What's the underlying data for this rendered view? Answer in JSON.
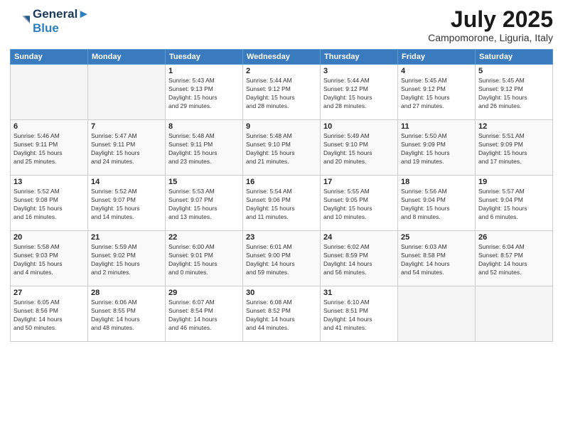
{
  "logo": {
    "line1": "General",
    "line2": "Blue"
  },
  "title": "July 2025",
  "subtitle": "Campomorone, Liguria, Italy",
  "header_days": [
    "Sunday",
    "Monday",
    "Tuesday",
    "Wednesday",
    "Thursday",
    "Friday",
    "Saturday"
  ],
  "weeks": [
    [
      {
        "day": "",
        "info": ""
      },
      {
        "day": "",
        "info": ""
      },
      {
        "day": "1",
        "info": "Sunrise: 5:43 AM\nSunset: 9:13 PM\nDaylight: 15 hours\nand 29 minutes."
      },
      {
        "day": "2",
        "info": "Sunrise: 5:44 AM\nSunset: 9:12 PM\nDaylight: 15 hours\nand 28 minutes."
      },
      {
        "day": "3",
        "info": "Sunrise: 5:44 AM\nSunset: 9:12 PM\nDaylight: 15 hours\nand 28 minutes."
      },
      {
        "day": "4",
        "info": "Sunrise: 5:45 AM\nSunset: 9:12 PM\nDaylight: 15 hours\nand 27 minutes."
      },
      {
        "day": "5",
        "info": "Sunrise: 5:45 AM\nSunset: 9:12 PM\nDaylight: 15 hours\nand 26 minutes."
      }
    ],
    [
      {
        "day": "6",
        "info": "Sunrise: 5:46 AM\nSunset: 9:11 PM\nDaylight: 15 hours\nand 25 minutes."
      },
      {
        "day": "7",
        "info": "Sunrise: 5:47 AM\nSunset: 9:11 PM\nDaylight: 15 hours\nand 24 minutes."
      },
      {
        "day": "8",
        "info": "Sunrise: 5:48 AM\nSunset: 9:11 PM\nDaylight: 15 hours\nand 23 minutes."
      },
      {
        "day": "9",
        "info": "Sunrise: 5:48 AM\nSunset: 9:10 PM\nDaylight: 15 hours\nand 21 minutes."
      },
      {
        "day": "10",
        "info": "Sunrise: 5:49 AM\nSunset: 9:10 PM\nDaylight: 15 hours\nand 20 minutes."
      },
      {
        "day": "11",
        "info": "Sunrise: 5:50 AM\nSunset: 9:09 PM\nDaylight: 15 hours\nand 19 minutes."
      },
      {
        "day": "12",
        "info": "Sunrise: 5:51 AM\nSunset: 9:09 PM\nDaylight: 15 hours\nand 17 minutes."
      }
    ],
    [
      {
        "day": "13",
        "info": "Sunrise: 5:52 AM\nSunset: 9:08 PM\nDaylight: 15 hours\nand 16 minutes."
      },
      {
        "day": "14",
        "info": "Sunrise: 5:52 AM\nSunset: 9:07 PM\nDaylight: 15 hours\nand 14 minutes."
      },
      {
        "day": "15",
        "info": "Sunrise: 5:53 AM\nSunset: 9:07 PM\nDaylight: 15 hours\nand 13 minutes."
      },
      {
        "day": "16",
        "info": "Sunrise: 5:54 AM\nSunset: 9:06 PM\nDaylight: 15 hours\nand 11 minutes."
      },
      {
        "day": "17",
        "info": "Sunrise: 5:55 AM\nSunset: 9:05 PM\nDaylight: 15 hours\nand 10 minutes."
      },
      {
        "day": "18",
        "info": "Sunrise: 5:56 AM\nSunset: 9:04 PM\nDaylight: 15 hours\nand 8 minutes."
      },
      {
        "day": "19",
        "info": "Sunrise: 5:57 AM\nSunset: 9:04 PM\nDaylight: 15 hours\nand 6 minutes."
      }
    ],
    [
      {
        "day": "20",
        "info": "Sunrise: 5:58 AM\nSunset: 9:03 PM\nDaylight: 15 hours\nand 4 minutes."
      },
      {
        "day": "21",
        "info": "Sunrise: 5:59 AM\nSunset: 9:02 PM\nDaylight: 15 hours\nand 2 minutes."
      },
      {
        "day": "22",
        "info": "Sunrise: 6:00 AM\nSunset: 9:01 PM\nDaylight: 15 hours\nand 0 minutes."
      },
      {
        "day": "23",
        "info": "Sunrise: 6:01 AM\nSunset: 9:00 PM\nDaylight: 14 hours\nand 59 minutes."
      },
      {
        "day": "24",
        "info": "Sunrise: 6:02 AM\nSunset: 8:59 PM\nDaylight: 14 hours\nand 56 minutes."
      },
      {
        "day": "25",
        "info": "Sunrise: 6:03 AM\nSunset: 8:58 PM\nDaylight: 14 hours\nand 54 minutes."
      },
      {
        "day": "26",
        "info": "Sunrise: 6:04 AM\nSunset: 8:57 PM\nDaylight: 14 hours\nand 52 minutes."
      }
    ],
    [
      {
        "day": "27",
        "info": "Sunrise: 6:05 AM\nSunset: 8:56 PM\nDaylight: 14 hours\nand 50 minutes."
      },
      {
        "day": "28",
        "info": "Sunrise: 6:06 AM\nSunset: 8:55 PM\nDaylight: 14 hours\nand 48 minutes."
      },
      {
        "day": "29",
        "info": "Sunrise: 6:07 AM\nSunset: 8:54 PM\nDaylight: 14 hours\nand 46 minutes."
      },
      {
        "day": "30",
        "info": "Sunrise: 6:08 AM\nSunset: 8:52 PM\nDaylight: 14 hours\nand 44 minutes."
      },
      {
        "day": "31",
        "info": "Sunrise: 6:10 AM\nSunset: 8:51 PM\nDaylight: 14 hours\nand 41 minutes."
      },
      {
        "day": "",
        "info": ""
      },
      {
        "day": "",
        "info": ""
      }
    ]
  ]
}
